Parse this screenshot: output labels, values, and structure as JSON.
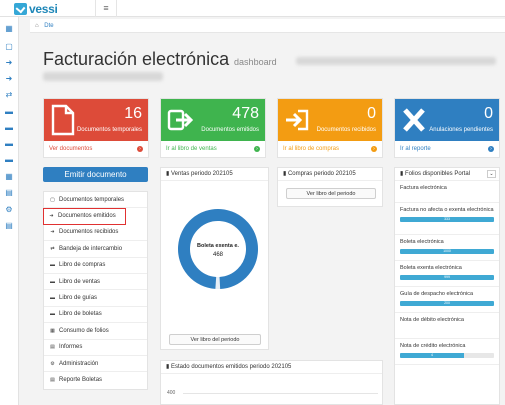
{
  "app": {
    "logo_text": "vessi",
    "menu_icon": "≡"
  },
  "breadcrumb": {
    "home": "⌂",
    "current": "Dte"
  },
  "header": {
    "title": "Facturación electrónica",
    "subtitle": "dashboard"
  },
  "stats": [
    {
      "value": "16",
      "label": "Documentos temporales",
      "link": "Ver documentos",
      "color": "#dd4b39",
      "icon": "document-icon"
    },
    {
      "value": "478",
      "label": "Documentos emitidos",
      "link": "Ir al libro de ventas",
      "color": "#3fb44e",
      "icon": "arrow-right-icon"
    },
    {
      "value": "0",
      "label": "Documentos recibidos",
      "link": "Ir al libro de compras",
      "color": "#f39c12",
      "icon": "sign-in-icon"
    },
    {
      "value": "0",
      "label": "Anulaciones pendientes",
      "link": "Ir al reporte",
      "color": "#2f7fc1",
      "icon": "x-icon"
    }
  ],
  "sidebar": {
    "emit_button": "Emitir documento",
    "items": [
      {
        "label": "Documentos temporales",
        "icon": "document-icon"
      },
      {
        "label": "Documentos emitidos",
        "icon": "arrow-right-icon"
      },
      {
        "label": "Documentos recibidos",
        "icon": "sign-in-icon"
      },
      {
        "label": "Bandeja de intercambio",
        "icon": "exchange-icon"
      },
      {
        "label": "Libro de compras",
        "icon": "book-icon"
      },
      {
        "label": "Libro de ventas",
        "icon": "book-icon"
      },
      {
        "label": "Libro de guías",
        "icon": "book-icon"
      },
      {
        "label": "Libro de boletas",
        "icon": "book-icon"
      },
      {
        "label": "Consumo de folios",
        "icon": "calendar-icon"
      },
      {
        "label": "Informes",
        "icon": "file-icon"
      },
      {
        "label": "Administración",
        "icon": "cogs-icon"
      },
      {
        "label": "Reporte Boletas",
        "icon": "file-icon"
      }
    ]
  },
  "ventas_panel": {
    "title": "Ventas periodo 202105",
    "button": "Ver libro del periodo",
    "chart_data": {
      "type": "pie",
      "slices": [
        {
          "label": "Boleta exenta e.",
          "value": 468
        },
        {
          "label": "",
          "value": 10
        }
      ],
      "center_label": "Boleta exenta e.",
      "center_value": "468",
      "colors": [
        "#2f7fc1",
        "#ffffff"
      ]
    }
  },
  "compras_panel": {
    "title": "Compras periodo 202105",
    "button": "Ver libro del periodo"
  },
  "estado_panel": {
    "title": "Estado documentos emitidos periodo 202105",
    "chart_data": {
      "type": "bar",
      "y_tick": "400"
    }
  },
  "folios_panel": {
    "title": "Folios disponibles Portal",
    "items": [
      {
        "label": "Factura electrónica",
        "value": "",
        "fill": 0
      },
      {
        "label": "Factura no afecta o exenta electrónica",
        "value": "333",
        "fill": 1
      },
      {
        "label": "Boleta electrónica",
        "value": "1000",
        "fill": 1
      },
      {
        "label": "Boleta exenta electrónica",
        "value": "999",
        "fill": 1
      },
      {
        "label": "Guía de despacho electrónica",
        "value": "200",
        "fill": 1
      },
      {
        "label": "Nota de débito electrónica",
        "value": "",
        "fill": 0
      },
      {
        "label": "Nota de crédito electrónica",
        "value": "4",
        "fill": 0.68
      }
    ]
  }
}
